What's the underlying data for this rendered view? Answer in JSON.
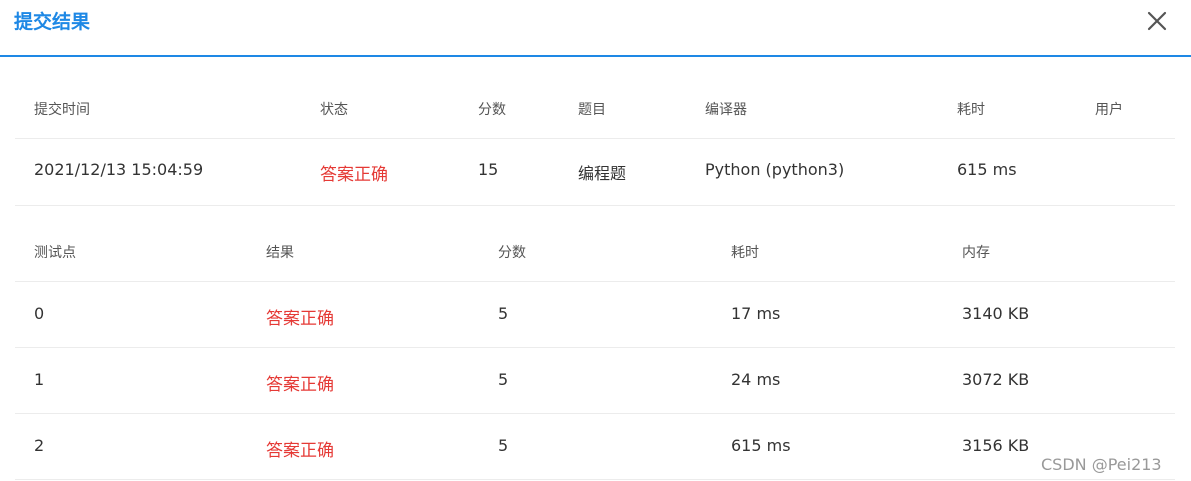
{
  "dialog": {
    "title": "提交结果",
    "close_icon": "close-icon"
  },
  "submission": {
    "headers": {
      "time": "提交时间",
      "status": "状态",
      "score": "分数",
      "problem": "题目",
      "compiler": "编译器",
      "duration": "耗时",
      "user": "用户"
    },
    "row": {
      "time": "2021/12/13 15:04:59",
      "status": "答案正确",
      "score": "15",
      "problem": "编程题",
      "compiler": "Python (python3)",
      "duration": "615 ms",
      "user": ""
    }
  },
  "testcases": {
    "headers": {
      "point": "测试点",
      "result": "结果",
      "score": "分数",
      "duration": "耗时",
      "memory": "内存"
    },
    "rows": [
      {
        "point": "0",
        "result": "答案正确",
        "score": "5",
        "duration": "17 ms",
        "memory": "3140 KB"
      },
      {
        "point": "1",
        "result": "答案正确",
        "score": "5",
        "duration": "24 ms",
        "memory": "3072 KB"
      },
      {
        "point": "2",
        "result": "答案正确",
        "score": "5",
        "duration": "615 ms",
        "memory": "3156 KB"
      }
    ]
  },
  "colors": {
    "accent": "#1e88e5",
    "status_ok": "#e53935"
  },
  "watermark": "CSDN @Pei213"
}
